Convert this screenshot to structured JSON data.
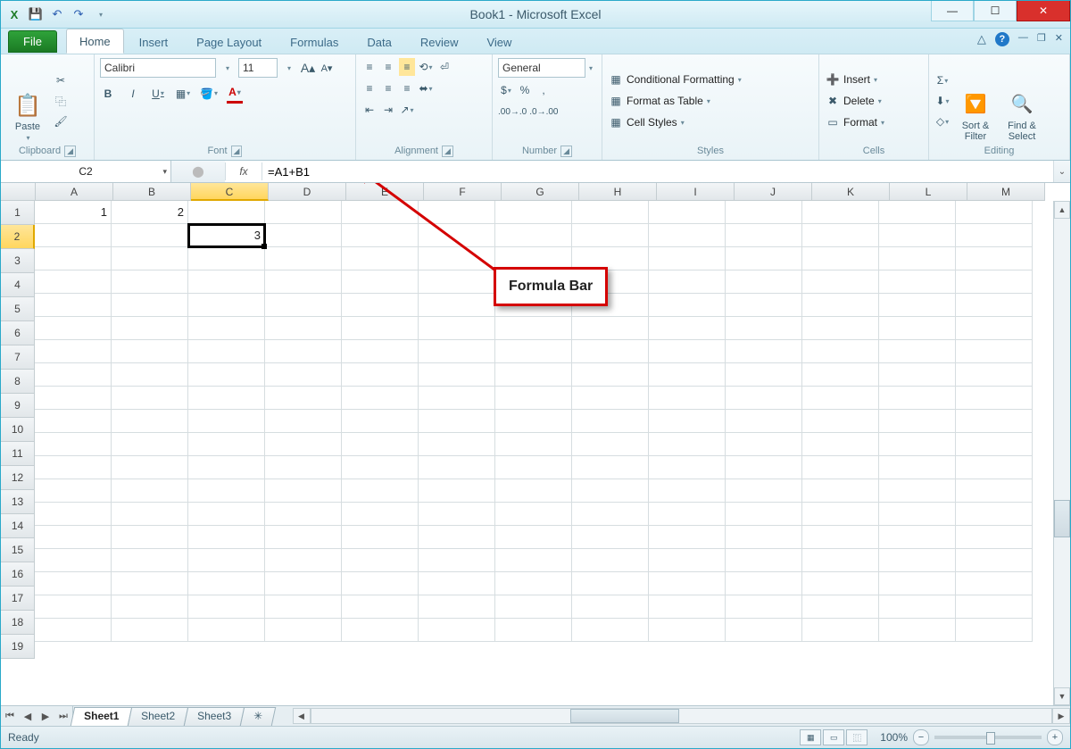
{
  "title": "Book1 - Microsoft Excel",
  "qat_icons": [
    "excel",
    "save",
    "undo",
    "redo"
  ],
  "tabs": {
    "file": "File",
    "list": [
      "Home",
      "Insert",
      "Page Layout",
      "Formulas",
      "Data",
      "Review",
      "View"
    ],
    "active": "Home"
  },
  "ribbon": {
    "clipboard": {
      "label": "Clipboard",
      "paste": "Paste"
    },
    "font": {
      "label": "Font",
      "name": "Calibri",
      "size": "11"
    },
    "alignment": {
      "label": "Alignment"
    },
    "number": {
      "label": "Number",
      "format": "General"
    },
    "styles": {
      "label": "Styles",
      "cond": "Conditional Formatting",
      "table": "Format as Table",
      "cell": "Cell Styles"
    },
    "cells": {
      "label": "Cells",
      "insert": "Insert",
      "delete": "Delete",
      "format": "Format"
    },
    "editing": {
      "label": "Editing",
      "sort": "Sort &\nFilter",
      "find": "Find &\nSelect"
    }
  },
  "namebox": "C2",
  "formula": "=A1+B1",
  "columns": [
    "A",
    "B",
    "C",
    "D",
    "E",
    "F",
    "G",
    "H",
    "I",
    "J",
    "K",
    "L",
    "M"
  ],
  "rows": 19,
  "selected_col": "C",
  "selected_row": 2,
  "cell_data": {
    "A1": "1",
    "B1": "2",
    "C2": "3"
  },
  "callout": "Formula Bar",
  "sheets": [
    "Sheet1",
    "Sheet2",
    "Sheet3"
  ],
  "active_sheet": "Sheet1",
  "status": "Ready",
  "zoom": "100%"
}
